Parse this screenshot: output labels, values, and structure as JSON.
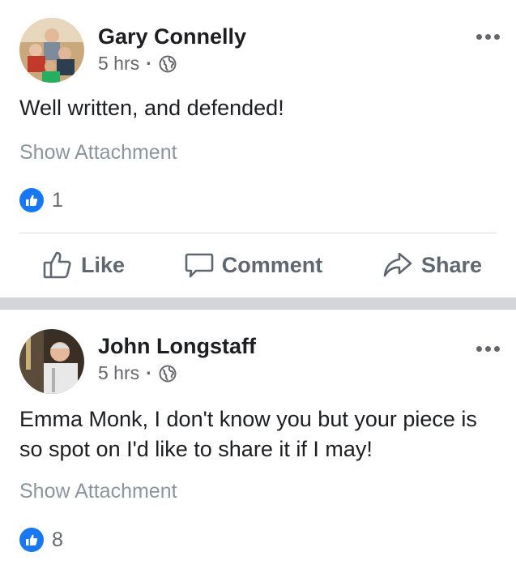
{
  "posts": [
    {
      "author": "Gary Connelly",
      "time": "5 hrs",
      "separator": "·",
      "privacy_icon": "globe-icon",
      "text": "Well written, and defended!",
      "attachment_label": "Show Attachment",
      "like_count": "1",
      "actions": {
        "like": "Like",
        "comment": "Comment",
        "share": "Share"
      }
    },
    {
      "author": "John Longstaff",
      "time": "5 hrs",
      "separator": "·",
      "privacy_icon": "globe-icon",
      "text": "Emma Monk, I don't know you but your piece is so spot on I'd like to share it if I may!",
      "attachment_label": "Show Attachment",
      "like_count": "8"
    }
  ],
  "colors": {
    "like_blue": "#1877f2",
    "separator_gray": "#d3d5d8",
    "muted_text": "#65676b"
  }
}
